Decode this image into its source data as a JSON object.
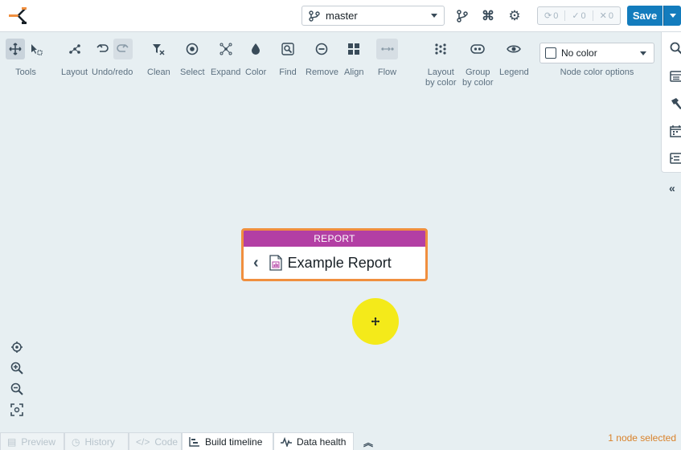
{
  "topbar": {
    "branch": "master",
    "status": [
      {
        "icon": "sync-icon",
        "count": "0"
      },
      {
        "icon": "check-icon",
        "count": "0"
      },
      {
        "icon": "x-icon",
        "count": "0"
      }
    ],
    "save_label": "Save"
  },
  "toolbar": {
    "tools": [
      {
        "label": "Tools"
      },
      {
        "label": "Layout"
      },
      {
        "label": "Undo/redo"
      },
      {
        "label": "Clean"
      },
      {
        "label": "Select"
      },
      {
        "label": "Expand"
      },
      {
        "label": "Color"
      },
      {
        "label": "Find"
      },
      {
        "label": "Remove"
      },
      {
        "label": "Align"
      },
      {
        "label": "Flow"
      },
      {
        "label_line1": "Layout",
        "label_line2": "by color"
      },
      {
        "label_line1": "Group",
        "label_line2": "by color"
      },
      {
        "label": "Legend"
      }
    ],
    "node_color": {
      "value": "No color",
      "label": "Node color options"
    }
  },
  "node": {
    "type_label": "REPORT",
    "title": "Example Report",
    "header_color": "#b33fa4",
    "border_color": "#f08f3f"
  },
  "bottom": {
    "tabs": [
      {
        "label": "Preview",
        "icon": "preview-icon"
      },
      {
        "label": "History",
        "icon": "history-icon"
      },
      {
        "label": "Code",
        "icon": "code-icon"
      },
      {
        "label": "Build timeline",
        "icon": "timeline-icon"
      },
      {
        "label": "Data health",
        "icon": "pulse-icon"
      }
    ],
    "selection_status": "1 node selected"
  },
  "colors": {
    "accent": "#137cbd",
    "canvas": "#e7eff2",
    "selection": "#d9822b"
  }
}
